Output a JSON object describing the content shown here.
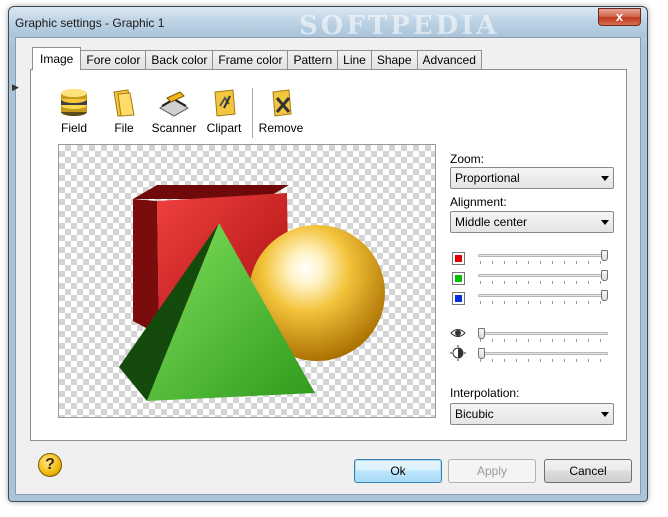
{
  "window": {
    "title": "Graphic settings - Graphic 1",
    "watermark": "SOFTPEDIA",
    "close_glyph": "x"
  },
  "tabs": [
    {
      "label": "Image",
      "active": true
    },
    {
      "label": "Fore color"
    },
    {
      "label": "Back color"
    },
    {
      "label": "Frame color"
    },
    {
      "label": "Pattern"
    },
    {
      "label": "Line"
    },
    {
      "label": "Shape"
    },
    {
      "label": "Advanced"
    }
  ],
  "toolbar": {
    "field": "Field",
    "file": "File",
    "scanner": "Scanner",
    "clipart": "Clipart",
    "remove": "Remove"
  },
  "zoom": {
    "label": "Zoom:",
    "value": "Proportional"
  },
  "alignment": {
    "label": "Alignment:",
    "value": "Middle center"
  },
  "colors": {
    "red_swatch": "#e00000",
    "green_swatch": "#00c000",
    "blue_swatch": "#0030e0",
    "red_level": 1.0,
    "green_level": 1.0,
    "blue_level": 1.0,
    "brightness_level": 0.0,
    "contrast_level": 0.0
  },
  "interpolation": {
    "label": "Interpolation:",
    "value": "Bicubic"
  },
  "buttons": {
    "ok": "Ok",
    "apply": "Apply",
    "cancel": "Cancel"
  },
  "help_glyph": "?"
}
